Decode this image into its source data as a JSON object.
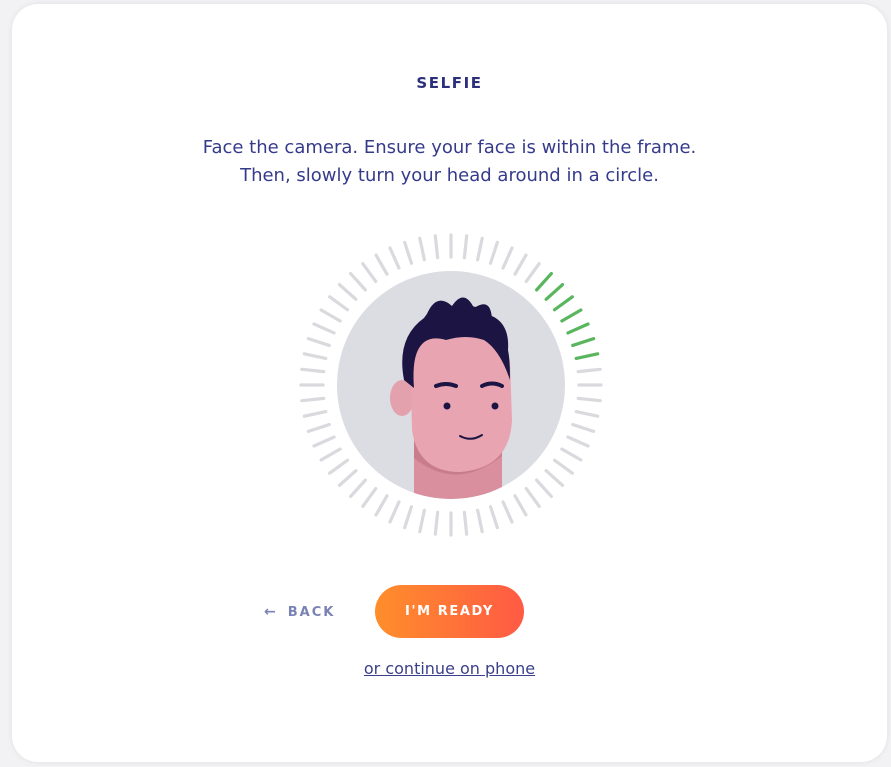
{
  "page": {
    "title": "SELFIE",
    "instructions": [
      "Face the camera. Ensure your face is within the frame.",
      "Then, slowly turn your head around in a circle."
    ]
  },
  "graphic": {
    "progress_ring": {
      "tick_count": 60,
      "progress_fraction": 0.12,
      "active_color": "#5ab65e",
      "inactive_color": "#d9d9de"
    },
    "face_circle_color": "#dcdce3",
    "skin_color": "#e8a5b1",
    "hair_color": "#1c1443"
  },
  "actions": {
    "back_icon": "arrow-left-icon",
    "back_label": "BACK",
    "ready_label": "I'M READY",
    "ready_gradient": [
      "#ff8e2b",
      "#ff5a44"
    ],
    "phone_link": "or continue on phone"
  },
  "colors": {
    "title": "#2b2f7c",
    "text": "#353b8a",
    "back": "#7b82b4"
  }
}
